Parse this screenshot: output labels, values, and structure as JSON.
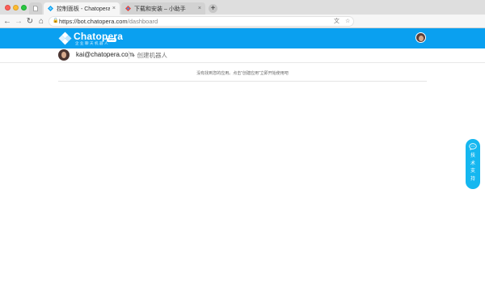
{
  "browser": {
    "tabs": [
      {
        "title": "",
        "icon": "page-icon"
      },
      {
        "title": "控制面板 - Chatopera - 领先的",
        "icon": "chatopera-favicon",
        "active": true
      },
      {
        "title": "下载和安装 – 小助手",
        "icon": "chatopera-favicon",
        "active": false
      }
    ],
    "new_tab": "+",
    "close": "×",
    "url": {
      "host": "https://bot.chatopera.com",
      "path": "/dashboard"
    }
  },
  "header": {
    "brand": "Chatopera",
    "tagline": "企业聊天机器人",
    "badge": "beta",
    "brand_color": "#0aa0f0"
  },
  "userbar": {
    "email": "kai@chatopera.com",
    "create_bot": "+ 创建机器人"
  },
  "main": {
    "empty_message": "没有找到您的应用。点击\"创建应用\"立即开始使用吧"
  },
  "support": {
    "label_lines": [
      "技",
      "术",
      "支",
      "持"
    ],
    "color": "#15b7f0"
  }
}
